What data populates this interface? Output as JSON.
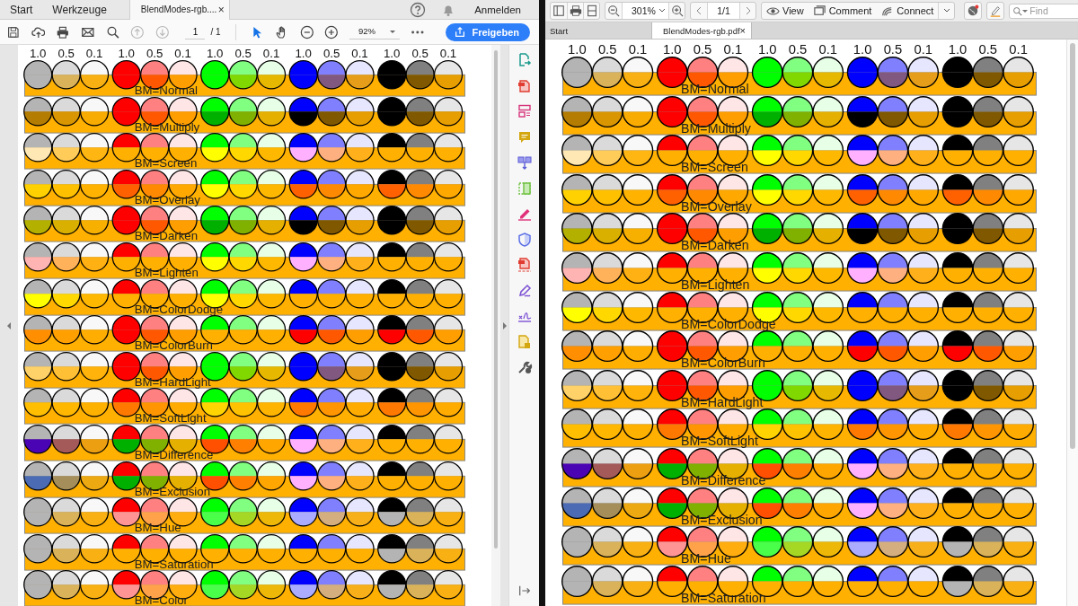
{
  "left_viewer": {
    "tabs": [
      {
        "label": "Start",
        "selected": false
      },
      {
        "label": "Werkzeuge",
        "selected": false
      },
      {
        "label": "BlendModes-rgb....",
        "selected": true,
        "close": "×"
      }
    ],
    "sign_in": "Anmelden",
    "nav_buttons": [
      {
        "kind": "up",
        "disabled": true
      },
      {
        "kind": "down",
        "disabled": true
      }
    ],
    "page_field": "1",
    "page_total": "/ 1",
    "tools": [
      {
        "kind": "pointer",
        "selected": true
      },
      {
        "kind": "hand",
        "selected": false
      }
    ],
    "zoom": "92%",
    "share_button": "Freigeben",
    "document": {
      "color_groups": [
        {
          "color": "#b4b4b4",
          "columns": [
            {
              "label": "1.0"
            },
            {
              "label": "0.5"
            },
            {
              "label": "0.1"
            }
          ]
        },
        {
          "color": "#ff0000",
          "columns": [
            {
              "label": "1.0"
            },
            {
              "label": "0.5"
            },
            {
              "label": "0.1"
            }
          ]
        },
        {
          "color": "#00ff00",
          "columns": [
            {
              "label": "1.0"
            },
            {
              "label": "0.5"
            },
            {
              "label": "0.1"
            }
          ]
        },
        {
          "color": "#0000ff",
          "columns": [
            {
              "label": "1.0"
            },
            {
              "label": "0.5"
            },
            {
              "label": "0.1"
            }
          ]
        },
        {
          "color": "#000000",
          "columns": [
            {
              "label": "1.0"
            },
            {
              "label": "0.5"
            },
            {
              "label": "0.1"
            }
          ]
        }
      ],
      "rows": [
        {
          "label": "BM=Normal",
          "kind": "normal"
        },
        {
          "label": "BM=Multiply",
          "kind": "multiply"
        },
        {
          "label": "BM=Screen",
          "kind": "screen"
        },
        {
          "label": "BM=Overlay",
          "kind": "overlay"
        },
        {
          "label": "BM=Darken",
          "kind": "darken"
        },
        {
          "label": "BM=Lighten",
          "kind": "lighten"
        },
        {
          "label": "BM=ColorDodge",
          "kind": "colordodge"
        },
        {
          "label": "BM=ColorBurn",
          "kind": "colorburn"
        },
        {
          "label": "BM=HardLight",
          "kind": "hardlight"
        },
        {
          "label": "BM=SoftLight",
          "kind": "softlight"
        },
        {
          "label": "BM=Difference",
          "kind": "difference"
        },
        {
          "label": "BM=Exclusion",
          "kind": "exclusion"
        },
        {
          "label": "BM=Hue",
          "kind": "hue"
        },
        {
          "label": "BM=Saturation",
          "kind": "saturation"
        },
        {
          "label": "BM=Color",
          "kind": "color"
        }
      ]
    }
  },
  "right_viewer": {
    "zoom": "301%",
    "page": "1/1",
    "buttons": [
      "View",
      "Comment",
      "Connect"
    ],
    "find": {
      "placeholder": "Find"
    },
    "tabs": [
      {
        "label": "Start",
        "selected": false
      },
      {
        "label": "BlendModes-rgb.pdf",
        "selected": true,
        "close": "×"
      }
    ],
    "document": {
      "color_groups": [
        {
          "color": "#b4b4b4",
          "columns": [
            {
              "label": "1.0"
            },
            {
              "label": "0.5"
            },
            {
              "label": "0.1"
            }
          ]
        },
        {
          "color": "#ff0000",
          "columns": [
            {
              "label": "1.0"
            },
            {
              "label": "0.5"
            },
            {
              "label": "0.1"
            }
          ]
        },
        {
          "color": "#00ff00",
          "columns": [
            {
              "label": "1.0"
            },
            {
              "label": "0.5"
            },
            {
              "label": "0.1"
            }
          ]
        },
        {
          "color": "#0000ff",
          "columns": [
            {
              "label": "1.0"
            },
            {
              "label": "0.5"
            },
            {
              "label": "0.1"
            }
          ]
        },
        {
          "color": "#000000",
          "columns": [
            {
              "label": "1.0"
            },
            {
              "label": "0.5"
            },
            {
              "label": "0.1"
            }
          ]
        }
      ],
      "rows": [
        {
          "label": "BM=Normal",
          "kind": "normal"
        },
        {
          "label": "BM=Multiply",
          "kind": "multiply"
        },
        {
          "label": "BM=Screen",
          "kind": "screen"
        },
        {
          "label": "BM=Overlay",
          "kind": "overlay"
        },
        {
          "label": "BM=Darken",
          "kind": "darken"
        },
        {
          "label": "BM=Lighten",
          "kind": "lighten"
        },
        {
          "label": "BM=ColorDodge",
          "kind": "colordodge"
        },
        {
          "label": "BM=ColorBurn",
          "kind": "colorburn"
        },
        {
          "label": "BM=HardLight",
          "kind": "hardlight"
        },
        {
          "label": "BM=SoftLight",
          "kind": "softlight"
        },
        {
          "label": "BM=Difference",
          "kind": "difference"
        },
        {
          "label": "BM=Exclusion",
          "kind": "exclusion"
        },
        {
          "label": "BM=Hue",
          "kind": "hue"
        },
        {
          "label": "BM=Saturation",
          "kind": "saturation"
        }
      ]
    }
  }
}
